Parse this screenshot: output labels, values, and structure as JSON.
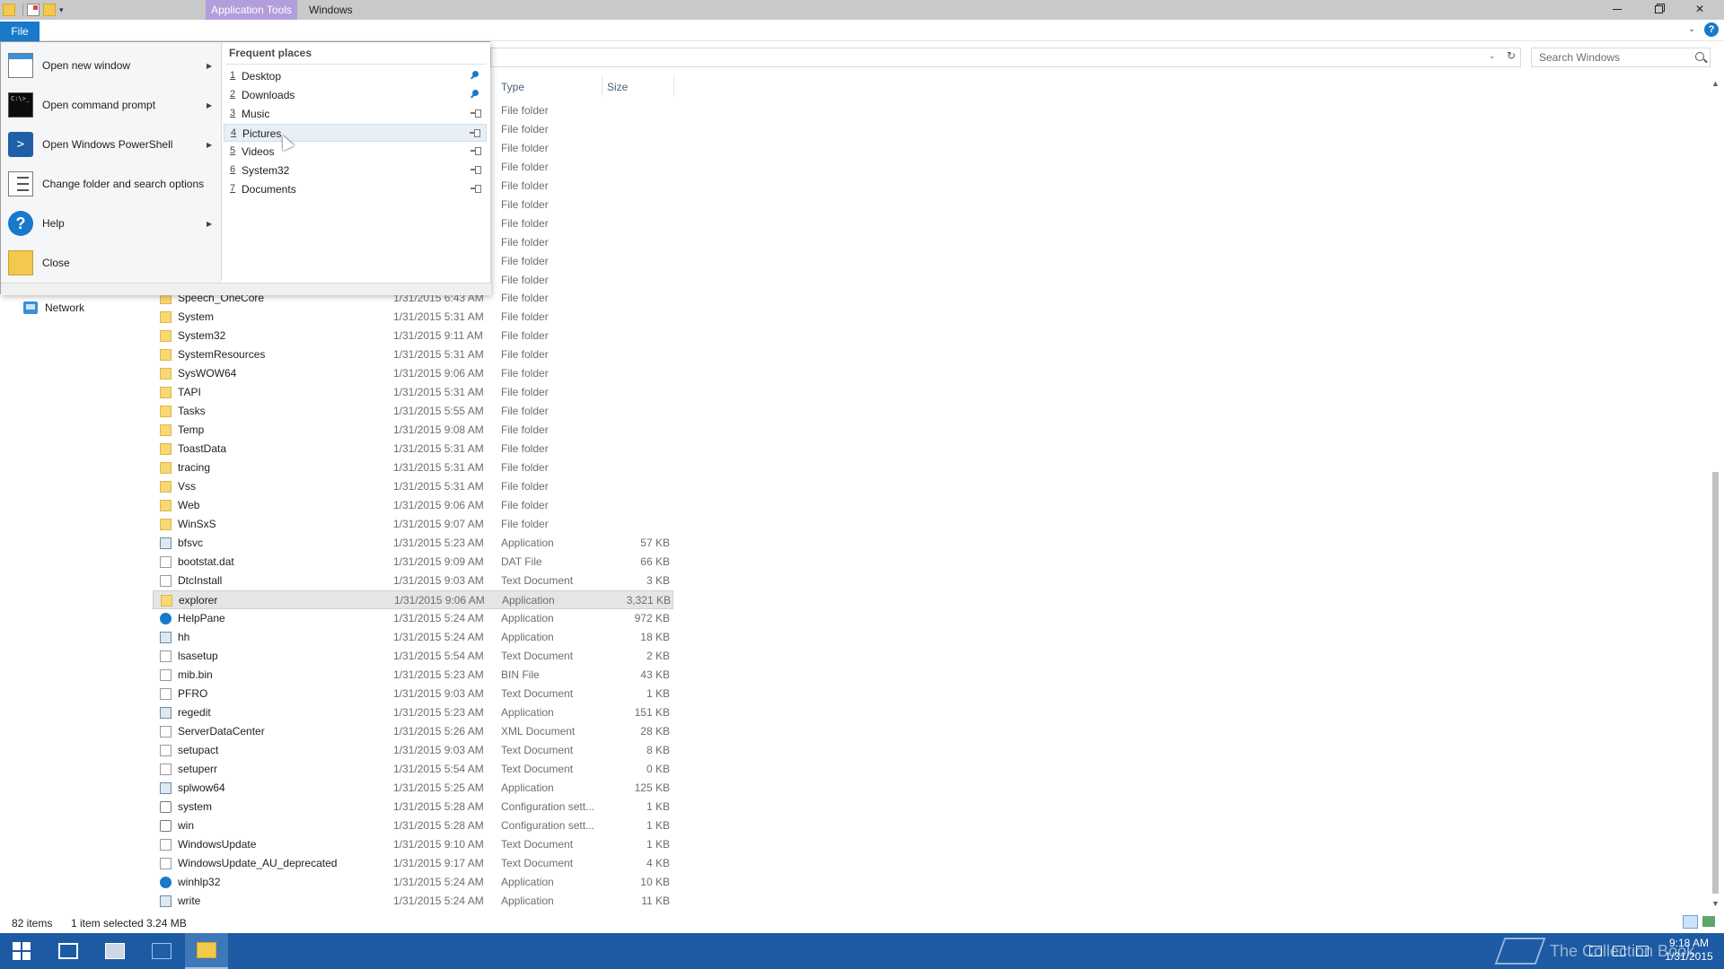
{
  "titlebar": {
    "contextual_tab": "Application Tools",
    "window_title": "Windows"
  },
  "ribbon": {
    "file_tab": "File"
  },
  "search": {
    "placeholder": "Search Windows"
  },
  "columns": {
    "type": "Type",
    "size": "Size"
  },
  "nav": {
    "network": "Network"
  },
  "file_menu": {
    "items": [
      {
        "label": "Open new window",
        "icon": "new-window-icon",
        "has_submenu": true
      },
      {
        "label": "Open command prompt",
        "icon": "command-prompt-icon",
        "has_submenu": true
      },
      {
        "label": "Open Windows PowerShell",
        "icon": "powershell-icon",
        "has_submenu": true
      },
      {
        "label": "Change folder and search options",
        "icon": "folder-options-icon",
        "has_submenu": false
      },
      {
        "label": "Help",
        "icon": "help-icon",
        "has_submenu": true
      },
      {
        "label": "Close",
        "icon": "close-icon",
        "has_submenu": false
      }
    ],
    "frequent_title": "Frequent places",
    "frequent": [
      {
        "num": "1",
        "name": "Desktop",
        "pinned": true
      },
      {
        "num": "2",
        "name": "Downloads",
        "pinned": true
      },
      {
        "num": "3",
        "name": "Music",
        "pinned": false
      },
      {
        "num": "4",
        "name": "Pictures",
        "pinned": false
      },
      {
        "num": "5",
        "name": "Videos",
        "pinned": false
      },
      {
        "num": "6",
        "name": "System32",
        "pinned": false
      },
      {
        "num": "7",
        "name": "Documents",
        "pinned": false
      }
    ]
  },
  "hidden_rows_type": [
    "File folder",
    "File folder",
    "File folder",
    "File folder",
    "File folder",
    "File folder",
    "File folder",
    "File folder",
    "File folder",
    "File folder"
  ],
  "files": [
    {
      "name": "Speech_OneCore",
      "date": "1/31/2015 6:43 AM",
      "type": "File folder",
      "size": "",
      "icon": "folder"
    },
    {
      "name": "System",
      "date": "1/31/2015 5:31 AM",
      "type": "File folder",
      "size": "",
      "icon": "folder"
    },
    {
      "name": "System32",
      "date": "1/31/2015 9:11 AM",
      "type": "File folder",
      "size": "",
      "icon": "folder"
    },
    {
      "name": "SystemResources",
      "date": "1/31/2015 5:31 AM",
      "type": "File folder",
      "size": "",
      "icon": "folder"
    },
    {
      "name": "SysWOW64",
      "date": "1/31/2015 9:06 AM",
      "type": "File folder",
      "size": "",
      "icon": "folder"
    },
    {
      "name": "TAPI",
      "date": "1/31/2015 5:31 AM",
      "type": "File folder",
      "size": "",
      "icon": "folder"
    },
    {
      "name": "Tasks",
      "date": "1/31/2015 5:55 AM",
      "type": "File folder",
      "size": "",
      "icon": "folder"
    },
    {
      "name": "Temp",
      "date": "1/31/2015 9:08 AM",
      "type": "File folder",
      "size": "",
      "icon": "folder"
    },
    {
      "name": "ToastData",
      "date": "1/31/2015 5:31 AM",
      "type": "File folder",
      "size": "",
      "icon": "folder"
    },
    {
      "name": "tracing",
      "date": "1/31/2015 5:31 AM",
      "type": "File folder",
      "size": "",
      "icon": "folder"
    },
    {
      "name": "Vss",
      "date": "1/31/2015 5:31 AM",
      "type": "File folder",
      "size": "",
      "icon": "folder"
    },
    {
      "name": "Web",
      "date": "1/31/2015 9:06 AM",
      "type": "File folder",
      "size": "",
      "icon": "folder"
    },
    {
      "name": "WinSxS",
      "date": "1/31/2015 9:07 AM",
      "type": "File folder",
      "size": "",
      "icon": "folder"
    },
    {
      "name": "bfsvc",
      "date": "1/31/2015 5:23 AM",
      "type": "Application",
      "size": "57 KB",
      "icon": "app"
    },
    {
      "name": "bootstat.dat",
      "date": "1/31/2015 9:09 AM",
      "type": "DAT File",
      "size": "66 KB",
      "icon": "doc"
    },
    {
      "name": "DtcInstall",
      "date": "1/31/2015 9:03 AM",
      "type": "Text Document",
      "size": "3 KB",
      "icon": "doc"
    },
    {
      "name": "explorer",
      "date": "1/31/2015 9:06 AM",
      "type": "Application",
      "size": "3,321 KB",
      "icon": "folder",
      "selected": true
    },
    {
      "name": "HelpPane",
      "date": "1/31/2015 5:24 AM",
      "type": "Application",
      "size": "972 KB",
      "icon": "help"
    },
    {
      "name": "hh",
      "date": "1/31/2015 5:24 AM",
      "type": "Application",
      "size": "18 KB",
      "icon": "app"
    },
    {
      "name": "lsasetup",
      "date": "1/31/2015 5:54 AM",
      "type": "Text Document",
      "size": "2 KB",
      "icon": "doc"
    },
    {
      "name": "mib.bin",
      "date": "1/31/2015 5:23 AM",
      "type": "BIN File",
      "size": "43 KB",
      "icon": "doc"
    },
    {
      "name": "PFRO",
      "date": "1/31/2015 9:03 AM",
      "type": "Text Document",
      "size": "1 KB",
      "icon": "doc"
    },
    {
      "name": "regedit",
      "date": "1/31/2015 5:23 AM",
      "type": "Application",
      "size": "151 KB",
      "icon": "app"
    },
    {
      "name": "ServerDataCenter",
      "date": "1/31/2015 5:26 AM",
      "type": "XML Document",
      "size": "28 KB",
      "icon": "doc"
    },
    {
      "name": "setupact",
      "date": "1/31/2015 9:03 AM",
      "type": "Text Document",
      "size": "8 KB",
      "icon": "doc"
    },
    {
      "name": "setuperr",
      "date": "1/31/2015 5:54 AM",
      "type": "Text Document",
      "size": "0 KB",
      "icon": "doc"
    },
    {
      "name": "splwow64",
      "date": "1/31/2015 5:25 AM",
      "type": "Application",
      "size": "125 KB",
      "icon": "app"
    },
    {
      "name": "system",
      "date": "1/31/2015 5:28 AM",
      "type": "Configuration sett...",
      "size": "1 KB",
      "icon": "cfg"
    },
    {
      "name": "win",
      "date": "1/31/2015 5:28 AM",
      "type": "Configuration sett...",
      "size": "1 KB",
      "icon": "cfg"
    },
    {
      "name": "WindowsUpdate",
      "date": "1/31/2015 9:10 AM",
      "type": "Text Document",
      "size": "1 KB",
      "icon": "doc"
    },
    {
      "name": "WindowsUpdate_AU_deprecated",
      "date": "1/31/2015 9:17 AM",
      "type": "Text Document",
      "size": "4 KB",
      "icon": "doc"
    },
    {
      "name": "winhlp32",
      "date": "1/31/2015 5:24 AM",
      "type": "Application",
      "size": "10 KB",
      "icon": "help"
    },
    {
      "name": "write",
      "date": "1/31/2015 5:24 AM",
      "type": "Application",
      "size": "11 KB",
      "icon": "app"
    }
  ],
  "status": {
    "items": "82 items",
    "selection": "1 item selected  3.24 MB"
  },
  "taskbar": {
    "watermark": "The Collection Book",
    "time": "9:18 AM",
    "date": "1/31/2015"
  }
}
